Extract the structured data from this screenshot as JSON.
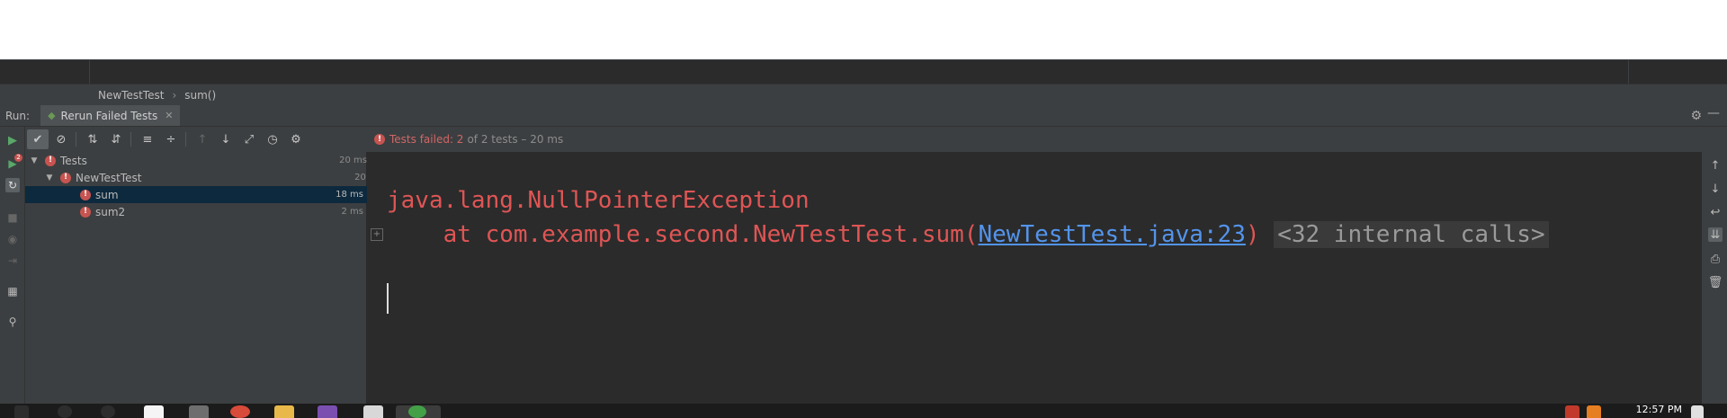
{
  "breadcrumb": {
    "items": [
      "NewTestTest",
      "sum()"
    ]
  },
  "run_window": {
    "label": "Run:",
    "tab_label": "Rerun Failed Tests",
    "left_badge_count": "2"
  },
  "status": {
    "failed_text": "Tests failed: 2",
    "rest_text": "of 2 tests – 20 ms"
  },
  "tree": {
    "rows": [
      {
        "label": "Tests",
        "time": "20 ms"
      },
      {
        "label": "NewTestTest",
        "time": "20 ms"
      },
      {
        "label": "sum",
        "time": "18 ms"
      },
      {
        "label": "sum2",
        "time": "2 ms"
      }
    ]
  },
  "console": {
    "exception": "java.lang.NullPointerException",
    "at_prefix": "    at com.example.second.NewTestTest.sum(",
    "link": "NewTestTest.java:23",
    "close_paren": ")",
    "internal_calls": "<32 internal calls>"
  },
  "taskbar": {
    "clock": "12:57 PM"
  },
  "colors": {
    "error": "#c75450",
    "link": "#5394ec",
    "selection": "#0d293e",
    "panel": "#3c3f41",
    "console_bg": "#2b2b2b"
  }
}
